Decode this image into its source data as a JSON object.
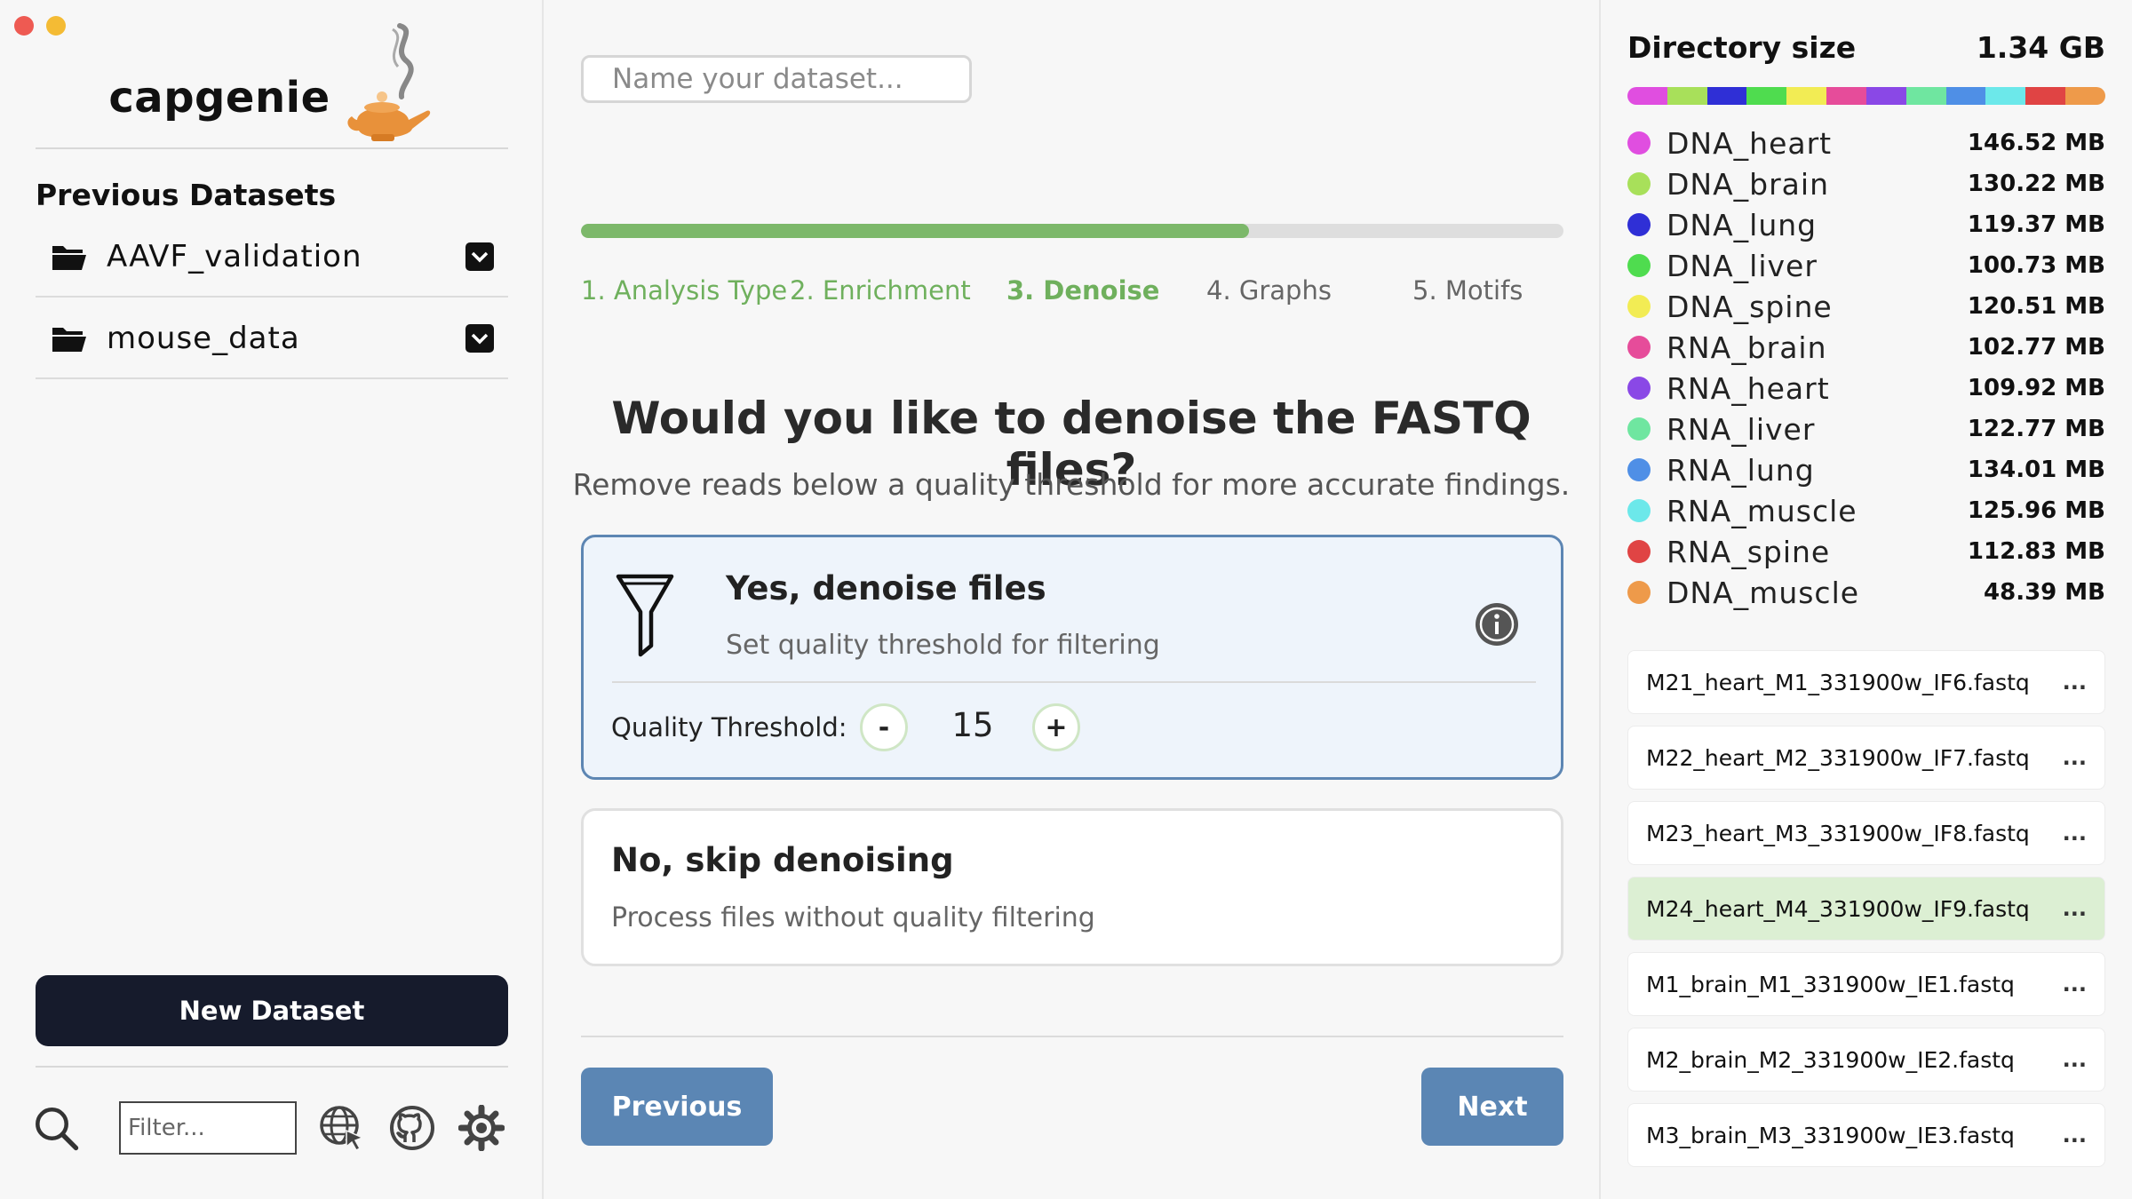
{
  "app": {
    "brand": "capgenie"
  },
  "sidebar": {
    "previous_title": "Previous Datasets",
    "datasets": [
      {
        "label": "AAVF_validation"
      },
      {
        "label": "mouse_data"
      }
    ],
    "new_dataset_label": "New Dataset",
    "filter_placeholder": "Filter...",
    "toolbar_icons": [
      "search-icon",
      "globe-cursor-icon",
      "github-icon",
      "settings-gear-icon"
    ]
  },
  "main": {
    "name_placeholder": "Name your dataset...",
    "progress": 0.68,
    "steps": [
      {
        "label": "1. Analysis Type",
        "state": "done"
      },
      {
        "label": "2. Enrichment",
        "state": "done"
      },
      {
        "label": "3. Denoise",
        "state": "current"
      },
      {
        "label": "4. Graphs",
        "state": "todo"
      },
      {
        "label": "5. Motifs",
        "state": "todo"
      }
    ],
    "question": "Would you like to denoise the FASTQ files?",
    "subtitle": "Remove reads below a quality threshold for more accurate findings.",
    "option_yes": {
      "title": "Yes, denoise files",
      "description": "Set quality threshold for filtering",
      "threshold_label": "Quality Threshold:",
      "decrement": "-",
      "increment": "+",
      "threshold_value": "15"
    },
    "option_no": {
      "title": "No, skip denoising",
      "description": "Process files without quality filtering"
    },
    "previous_label": "Previous",
    "next_label": "Next"
  },
  "right_panel": {
    "title": "Directory size",
    "total": "1.34 GB",
    "items": [
      {
        "name": "DNA_heart",
        "size": "146.52 MB",
        "color": "#e04ee0"
      },
      {
        "name": "DNA_brain",
        "size": "130.22 MB",
        "color": "#a8e05a"
      },
      {
        "name": "DNA_lung",
        "size": "119.37 MB",
        "color": "#2f2fd6"
      },
      {
        "name": "DNA_liver",
        "size": "100.73 MB",
        "color": "#4fdc4f"
      },
      {
        "name": "DNA_spine",
        "size": "120.51 MB",
        "color": "#f2ec54"
      },
      {
        "name": "RNA_brain",
        "size": "102.77 MB",
        "color": "#e64c9a"
      },
      {
        "name": "RNA_heart",
        "size": "109.92 MB",
        "color": "#8a48e6"
      },
      {
        "name": "RNA_liver",
        "size": "122.77 MB",
        "color": "#6fe6a0"
      },
      {
        "name": "RNA_lung",
        "size": "134.01 MB",
        "color": "#4f8fe6"
      },
      {
        "name": "RNA_muscle",
        "size": "125.96 MB",
        "color": "#6ce8ea"
      },
      {
        "name": "RNA_spine",
        "size": "112.83 MB",
        "color": "#e04444"
      },
      {
        "name": "DNA_muscle",
        "size": "48.39 MB",
        "color": "#ee9a4a"
      }
    ],
    "files": [
      {
        "name": "M21_heart_M1_331900w_IF6.fastq",
        "more": "...",
        "active": false
      },
      {
        "name": "M22_heart_M2_331900w_IF7.fastq",
        "more": "...",
        "active": false
      },
      {
        "name": "M23_heart_M3_331900w_IF8.fastq",
        "more": "...",
        "active": false
      },
      {
        "name": "M24_heart_M4_331900w_IF9.fastq",
        "more": "...",
        "active": true
      },
      {
        "name": "M1_brain_M1_331900w_IE1.fastq",
        "more": "...",
        "active": false
      },
      {
        "name": "M2_brain_M2_331900w_IE2.fastq",
        "more": "...",
        "active": false
      },
      {
        "name": "M3_brain_M3_331900w_IE3.fastq",
        "more": "...",
        "active": false
      }
    ]
  }
}
